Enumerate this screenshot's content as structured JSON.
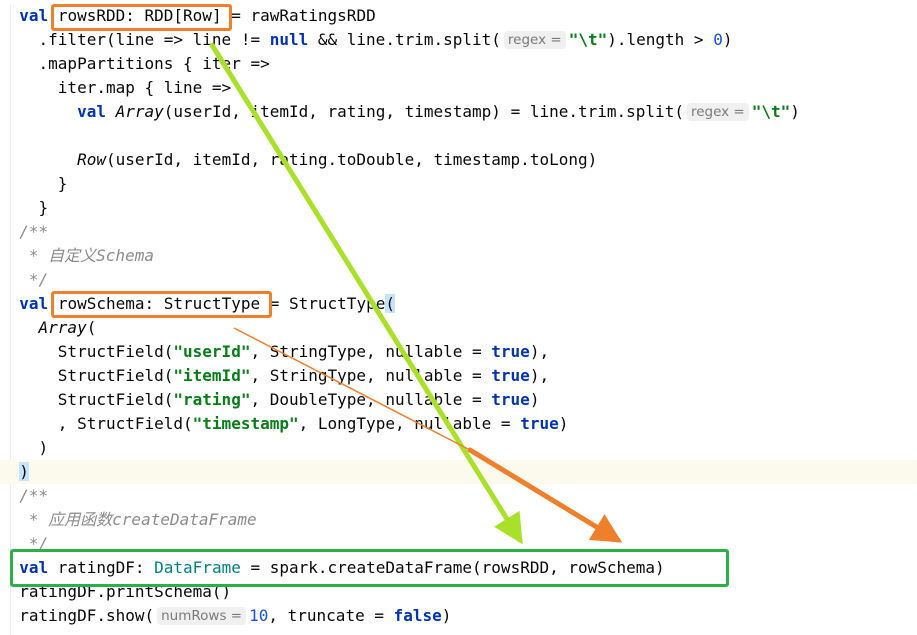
{
  "code": {
    "l1": {
      "kw": "val",
      "boxed": "rowsRDD: RDD[Row]",
      "rest": " = rawRatingsRDD"
    },
    "l2": {
      "a": "  .filter(line => line != ",
      "kw": "null",
      "b": " && line.trim.split(",
      "hint": "regex =",
      "str": "\"\\t\"",
      "c": ").length > ",
      "num": "0",
      "d": ")"
    },
    "l3": {
      "text": "  .mapPartitions { iter =>"
    },
    "l4": {
      "text": "    iter.map { line =>"
    },
    "l5": {
      "indent": "      ",
      "kw": "val",
      "it": "Array",
      "a": "(userId, itemId, rating, timestamp) = line.trim.split(",
      "hint": "regex =",
      "str": "\"\\t\"",
      "b": ")"
    },
    "l7": {
      "indent": "      ",
      "it": "Row",
      "a": "(userId, itemId, rating.toDouble, timestamp.toLong)"
    },
    "l8": {
      "text": "    }"
    },
    "l9": {
      "text": "  }"
    },
    "l10": {
      "text": "/**"
    },
    "l11": {
      "text": " * 自定义Schema"
    },
    "l12": {
      "text": " */"
    },
    "l13": {
      "kw": "val",
      "boxed": "rowSchema: StructType",
      "a": " = StructType",
      "bracket": "("
    },
    "l14": {
      "indent": "  ",
      "it": "Array",
      "a": "("
    },
    "l15": {
      "a": "    StructField(",
      "str": "\"userId\"",
      "b": ", StringType, nullable = ",
      "kw": "true",
      "c": "),"
    },
    "l16": {
      "a": "    StructField(",
      "str": "\"itemId\"",
      "b": ", StringType, nullable = ",
      "kw": "true",
      "c": "),"
    },
    "l17": {
      "a": "    StructField(",
      "str": "\"rating\"",
      "b": ", DoubleType, nullable = ",
      "kw": "true",
      "c": ")"
    },
    "l18": {
      "a": "    , StructField(",
      "str": "\"timestamp\"",
      "b": ", LongType, nullable = ",
      "kw": "true",
      "c": ")"
    },
    "l19": {
      "text": "  )"
    },
    "l20": {
      "bracket": ")"
    },
    "l21": {
      "text": "/**"
    },
    "l22": {
      "text": " * 应用函数createDataFrame"
    },
    "l23": {
      "text": " */"
    },
    "l24": {
      "kw": "val",
      "a": " ratingDF: ",
      "type": "DataFrame",
      "b": " = spark.createDataFrame(rowsRDD, rowSchema)"
    },
    "l25": {
      "text": "ratingDF.printSchema()"
    },
    "l26": {
      "a": "ratingDF.show(",
      "hint": "numRows =",
      "num": "10",
      "b": ", truncate = ",
      "kw": "false",
      "c": ")"
    }
  },
  "annotations": {
    "orange_color": "#f07f2b",
    "green_color": "#2bb048",
    "lime_arrow_color": "#a8e02a",
    "orange_arrow_color": "#f07f2b"
  }
}
